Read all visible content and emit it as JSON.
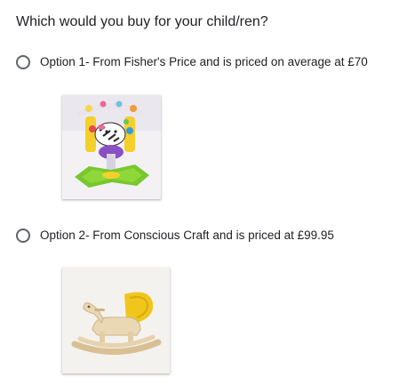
{
  "question": {
    "title": "Which would you buy for your child/ren?"
  },
  "options": [
    {
      "label": "Option 1- From Fisher's Price and is priced on average at £70",
      "image": "jumperoo-zebra-toy-photo"
    },
    {
      "label": "Option 2- From Conscious Craft and is priced at £99.95",
      "image": "wooden-rocking-horse-photo"
    }
  ],
  "colors": {
    "radio_border": "#5f6368",
    "text": "#202124"
  }
}
